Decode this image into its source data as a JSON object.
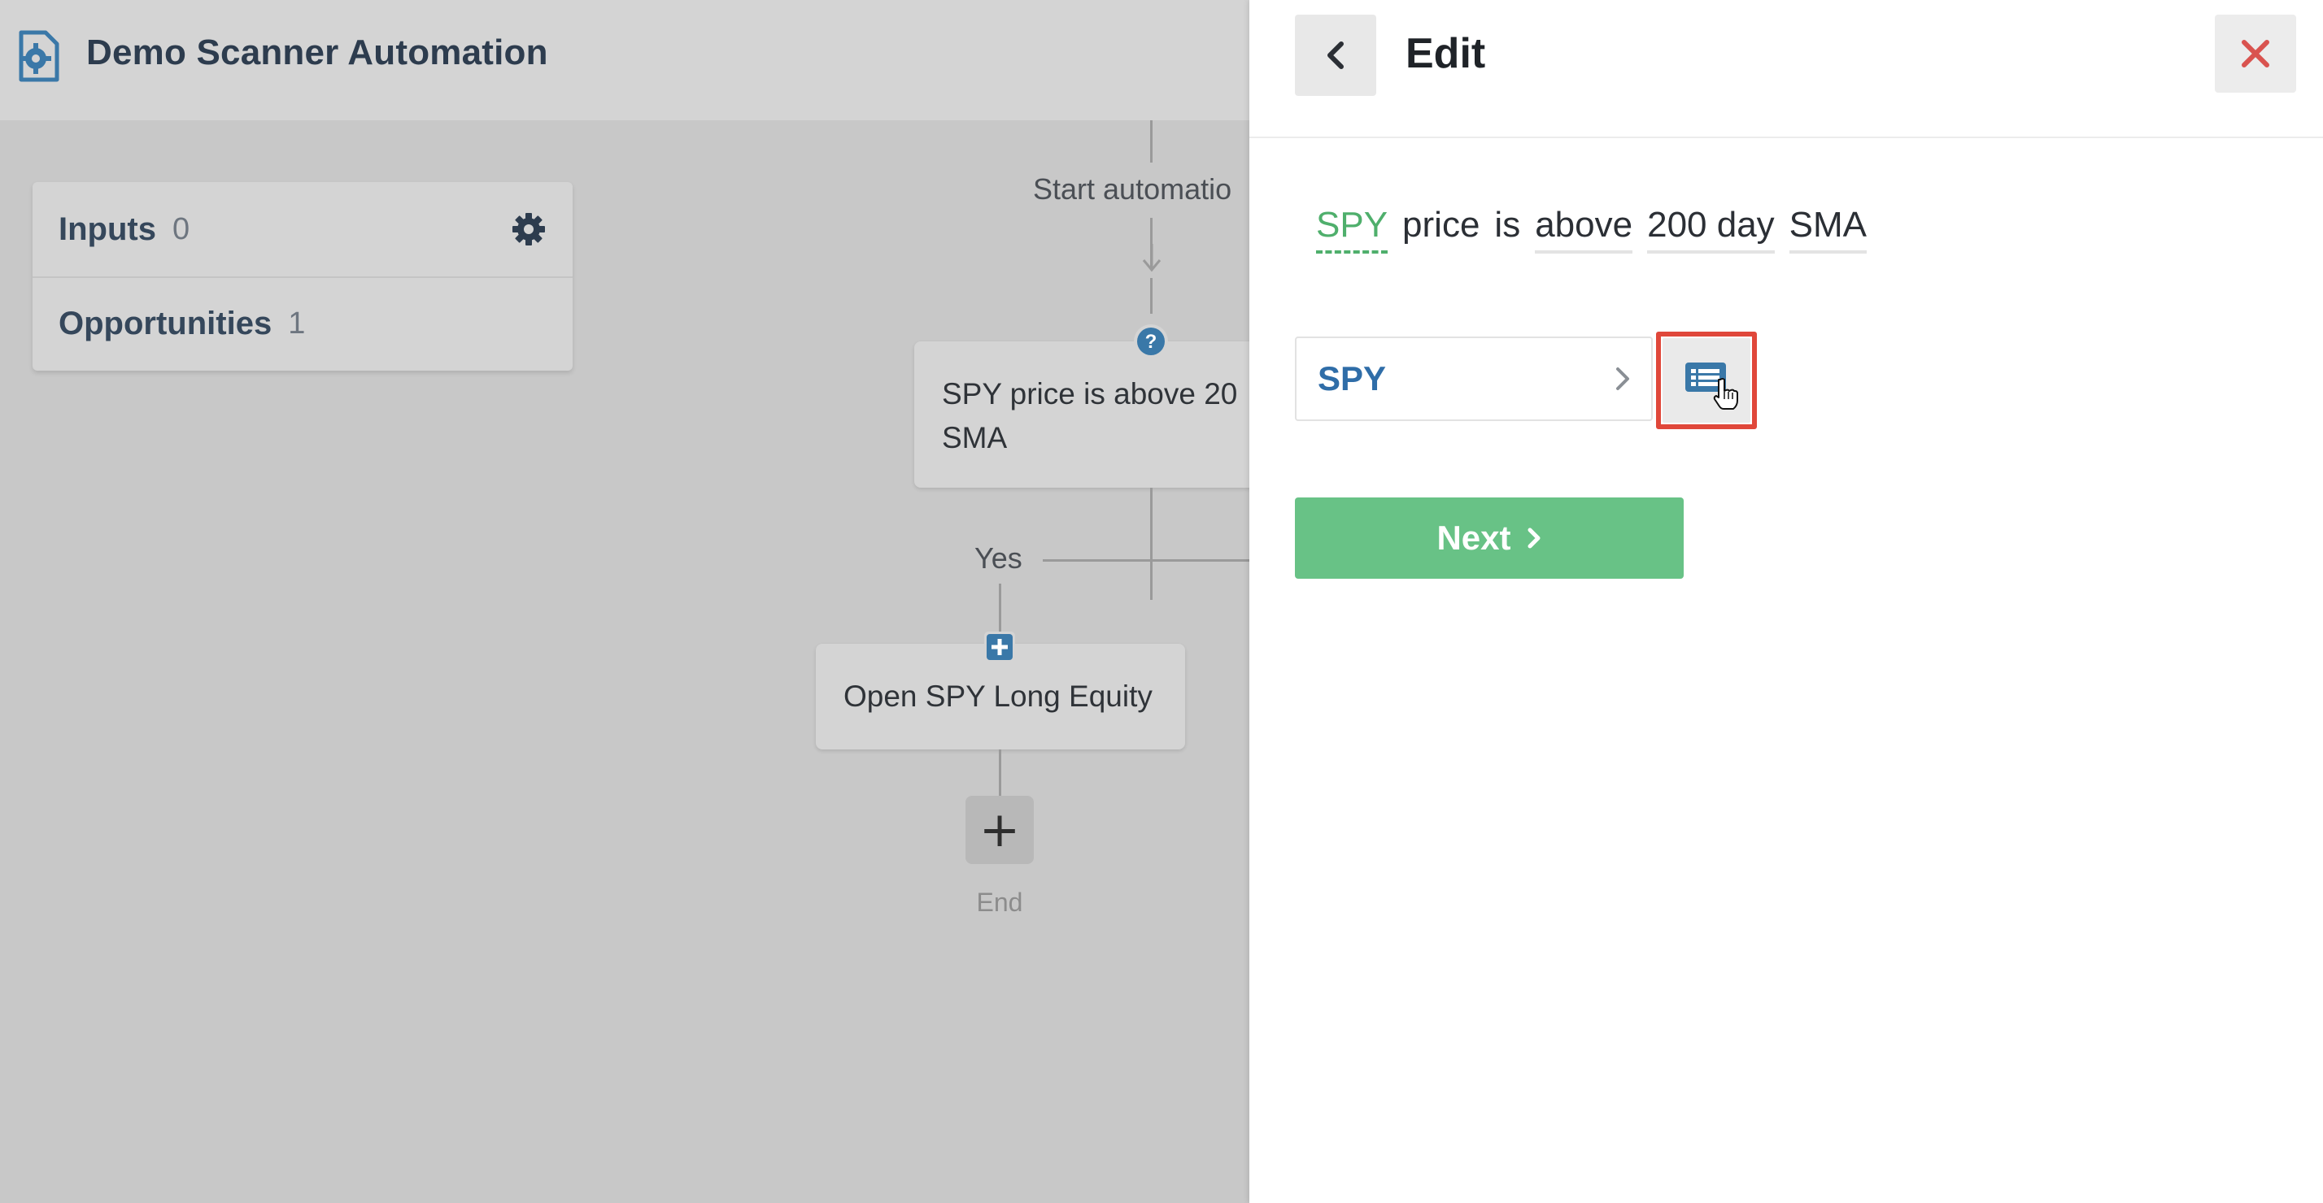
{
  "app": {
    "title": "Demo Scanner Automation"
  },
  "sidebar": {
    "inputs": {
      "label": "Inputs",
      "count": "0"
    },
    "opportunities": {
      "label": "Opportunities",
      "count": "1"
    }
  },
  "flow": {
    "start_label": "Start automatio",
    "condition_text_line1": "SPY price is above 20",
    "condition_text_line2": "SMA",
    "yes_label": "Yes",
    "action_text": "Open SPY Long Equity",
    "add_symbol": "+",
    "end_label": "End"
  },
  "panel": {
    "title": "Edit",
    "expression": {
      "symbol": "SPY",
      "w1": "price",
      "w2": "is",
      "comparator": "above",
      "period": "200 day",
      "indicator": "SMA"
    },
    "symbol_field": {
      "value": "SPY"
    },
    "next_button": {
      "label": "Next"
    }
  },
  "colors": {
    "accent_green": "#68c286",
    "symbol_green": "#4faf6c",
    "link_blue": "#2f6da8",
    "highlight_red": "#e0473a",
    "close_red": "#d9534f"
  }
}
